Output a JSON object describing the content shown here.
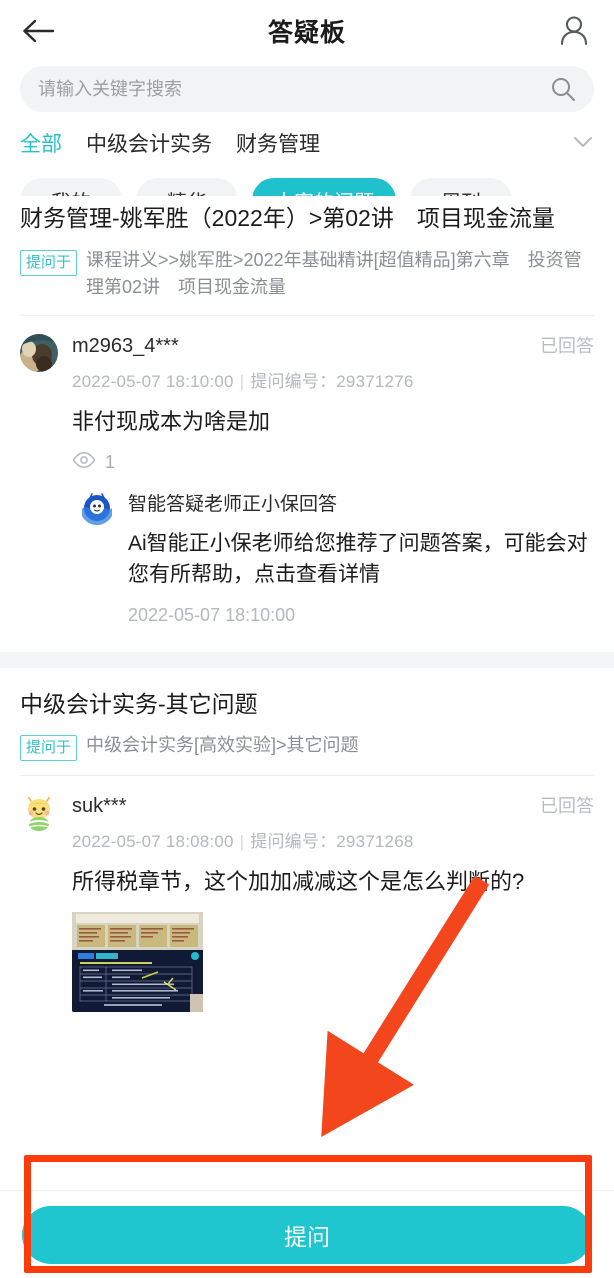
{
  "header": {
    "title": "答疑板",
    "back_icon": "arrow-left-icon",
    "profile_icon": "user-icon"
  },
  "search": {
    "placeholder": "请输入关键字搜索",
    "value": "",
    "icon": "search-icon"
  },
  "categories": {
    "items": [
      {
        "label": "全部",
        "active": true
      },
      {
        "label": "中级会计实务",
        "active": false
      },
      {
        "label": "财务管理",
        "active": false
      }
    ],
    "expand_icon": "chevron-down-icon"
  },
  "chips": [
    {
      "label": "我的",
      "active": false
    },
    {
      "label": "精华",
      "active": false
    },
    {
      "label": "大家的问题",
      "active": true
    },
    {
      "label": "周刊",
      "active": false
    }
  ],
  "groups": [
    {
      "title": "财务管理-姚军胜（2022年）>第02讲　项目现金流量",
      "ask_from_tag": "提问于",
      "ask_from_text": "课程讲义>>姚军胜>2022年基础精讲[超值精品]第六章　投资管理第02讲　项目现金流量",
      "post": {
        "avatar": "user-photo-avatar",
        "user": "m2963_4***",
        "status": "已回答",
        "time": "2022-05-07 18:10:00",
        "meta_separator": "|",
        "id_label": "提问编号：",
        "id_value": "29371276",
        "text": "非付现成本为啥是加",
        "views_icon": "eye-icon",
        "views": "1"
      },
      "ai_reply": {
        "avatar": "ai-assistant-avatar",
        "name": "智能答疑老师正小保回答",
        "text": "Ai智能正小保老师给您推荐了问题答案，可能会对您有所帮助，点击查看详情",
        "time": "2022-05-07 18:10:00"
      }
    },
    {
      "title": "中级会计实务-其它问题",
      "ask_from_tag": "提问于",
      "ask_from_text": "中级会计实务[高效实验]>其它问题",
      "post": {
        "avatar": "bee-cartoon-avatar",
        "user": "suk***",
        "status": "已回答",
        "time": "2022-05-07 18:08:00",
        "meta_separator": "|",
        "id_label": "提问编号：",
        "id_value": "29371268",
        "text": "所得税章节，这个加加减减这个是怎么判断的?",
        "attachment": "question-screenshot-thumbnail"
      }
    }
  ],
  "bottom": {
    "ask_label": "提问"
  },
  "annotations": {
    "highlight_color": "#fb3b0b",
    "arrow": "red-arrow-pointing-down-left",
    "rect": "red-highlight-rectangle-around-ask-button"
  },
  "colors": {
    "accent_teal": "#1fc2cc",
    "chip_bg": "#f2f3f5",
    "text_primary": "#1c1c1c",
    "text_muted": "#b4b7bc",
    "annotation_red": "#fb3b0b"
  }
}
